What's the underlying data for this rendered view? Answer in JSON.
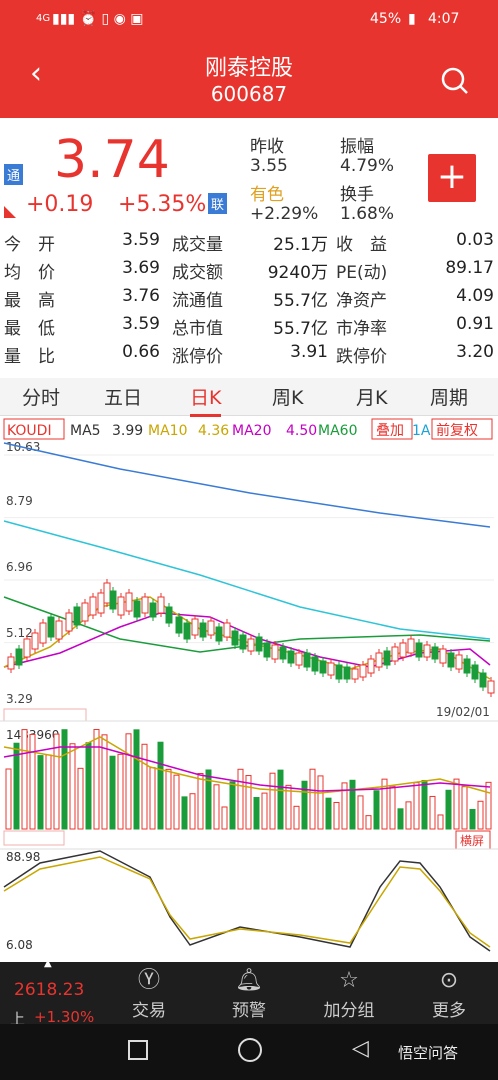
{
  "status": {
    "left": "4G",
    "battery": "45%",
    "time": "4:07"
  },
  "header": {
    "title": "刚泰控股",
    "code": "600687"
  },
  "quote": {
    "price": "3.74",
    "change": "+0.19",
    "change_pct": "+5.35%",
    "badge_tong": "通",
    "badge_lian": "联",
    "prev_close_label": "昨收",
    "prev_close": "3.55",
    "amplitude_label": "振幅",
    "amplitude": "4.79%",
    "sector_label": "有色",
    "sector_change": "+2.29%",
    "turnover_label": "换手",
    "turnover": "1.68%",
    "add_label": "+"
  },
  "stats": [
    {
      "l1": "今　开",
      "v1": "3.59",
      "l2": "成交量",
      "v2": "25.1万",
      "l3": "收　益",
      "v3": "0.03"
    },
    {
      "l1": "均　价",
      "v1": "3.69",
      "l2": "成交额",
      "v2": "9240万",
      "l3": "PE(动)",
      "v3": "89.17"
    },
    {
      "l1": "最　高",
      "v1": "3.76",
      "l2": "流通值",
      "v2": "55.7亿",
      "l3": "净资产",
      "v3": "4.09"
    },
    {
      "l1": "最　低",
      "v1": "3.59",
      "l2": "总市值",
      "v2": "55.7亿",
      "l3": "市净率",
      "v3": "0.91"
    },
    {
      "l1": "量　比",
      "v1": "0.66",
      "l2": "涨停价",
      "v2": "3.91",
      "l3": "跌停价",
      "v3": "3.20"
    }
  ],
  "tabs": [
    "分时",
    "五日",
    "日K",
    "周K",
    "月K",
    "周期"
  ],
  "active_tab": "日K",
  "ma": {
    "koudi": "KOUDI",
    "ma5": "MA5",
    "ma5v": "3.99",
    "ma10": "MA10",
    "ma10v": "4.36",
    "ma20": "MA20",
    "ma20v": "4.50",
    "ma60": "MA60",
    "overlay": "叠加",
    "adj": "前复权",
    "ma_cut": "1A"
  },
  "price_axis": [
    "10.63",
    "8.79",
    "6.96",
    "5.12",
    "3.29"
  ],
  "date_label": "19/02/01",
  "vol_label": "1483960",
  "hengping": "横屏",
  "kdj_axis": [
    "88.98",
    "6.08"
  ],
  "nav": {
    "index": "2618.23",
    "index_prefix": "上",
    "index_change": "+1.30%",
    "items": [
      {
        "label": "交易",
        "icon": "yen-icon"
      },
      {
        "label": "预警",
        "icon": "bell-icon"
      },
      {
        "label": "加分组",
        "icon": "star-icon"
      },
      {
        "label": "更多",
        "icon": "more-icon"
      }
    ]
  },
  "watermark": "悟空问答",
  "colors": {
    "red": "#e8342f",
    "green": "#1a9c3a"
  },
  "chart_data": {
    "type": "candlestick",
    "ylim": [
      3.29,
      10.63
    ],
    "series": [
      {
        "name": "MA5",
        "value": 3.99
      },
      {
        "name": "MA10",
        "value": 4.36
      },
      {
        "name": "MA20",
        "value": 4.5
      },
      {
        "name": "MA60",
        "value": null
      }
    ],
    "volume_max": 1483960,
    "kdj_range": [
      6.08,
      88.98
    ],
    "last_date": "19/02/01"
  }
}
